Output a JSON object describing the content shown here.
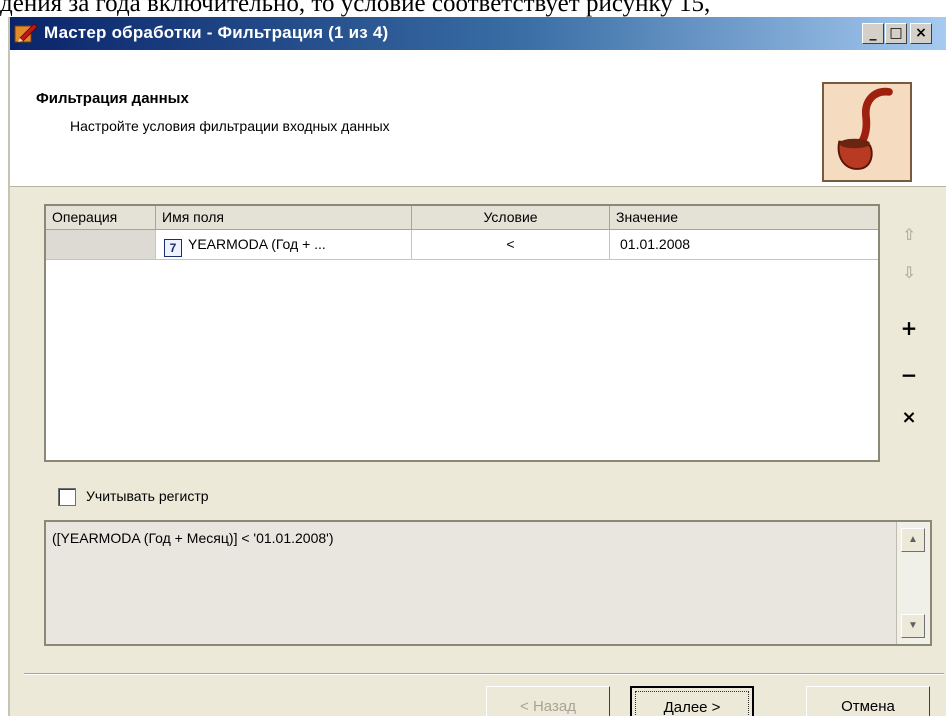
{
  "caption_fragment": "дения за года включительно, то условие соответствует рисунку 15,",
  "window": {
    "title": "Мастер обработки - Фильтрация (1 из 4)",
    "controls": {
      "minimize": "_",
      "maximize": "□",
      "close": "×"
    }
  },
  "header": {
    "title": "Фильтрация данных",
    "subtitle": "Настройте условия фильтрации входных данных",
    "logo_icon": "pipe-s-logo-icon"
  },
  "grid": {
    "columns": [
      "Операция",
      "Имя поля",
      "Условие",
      "Значение"
    ],
    "rows": [
      {
        "operation": "",
        "field_icon_glyph": "7",
        "field": "YEARMODA (Год + ...",
        "condition": "<",
        "value": "01.01.2008"
      }
    ]
  },
  "side_buttons": {
    "up": "⇧",
    "down": "⇩",
    "add": "+",
    "remove": "−",
    "clear": "×"
  },
  "case_sensitive": {
    "label": "Учитывать регистр",
    "checked": false
  },
  "expression": "([YEARMODA (Год + Месяц)] < '01.01.2008')",
  "buttons": {
    "back": "< Назад",
    "next": "Далее >",
    "cancel": "Отмена"
  },
  "colors": {
    "title_start": "#0a246a",
    "title_end": "#a6caf0",
    "face": "#ece9d8"
  }
}
